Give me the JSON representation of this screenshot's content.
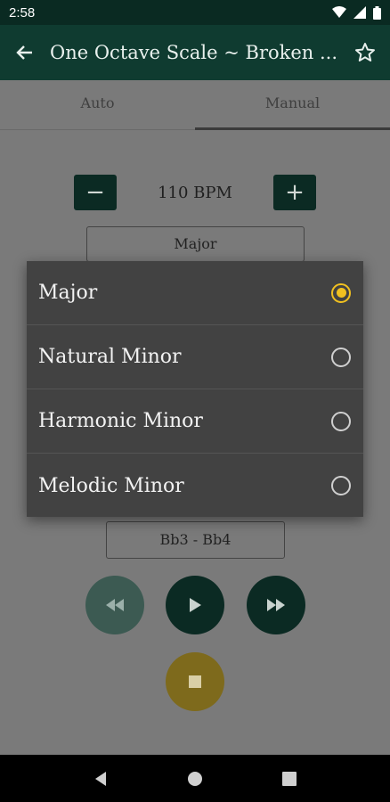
{
  "status_bar": {
    "time": "2:58"
  },
  "app_bar": {
    "title": "One Octave Scale ~ Broken ..."
  },
  "tabs": [
    {
      "label": "Auto"
    },
    {
      "label": "Manual"
    }
  ],
  "tempo": {
    "minus": "−",
    "value": "110 BPM",
    "plus": "+"
  },
  "scale_select": {
    "value": "Major"
  },
  "range_select": {
    "value": "Bb3 - Bb4"
  },
  "dialog": {
    "options": [
      {
        "label": "Major",
        "selected": true
      },
      {
        "label": "Natural Minor",
        "selected": false
      },
      {
        "label": "Harmonic Minor",
        "selected": false
      },
      {
        "label": "Melodic Minor",
        "selected": false
      }
    ]
  },
  "colors": {
    "accent": "#f0c020",
    "primary": "#0f3b30"
  }
}
